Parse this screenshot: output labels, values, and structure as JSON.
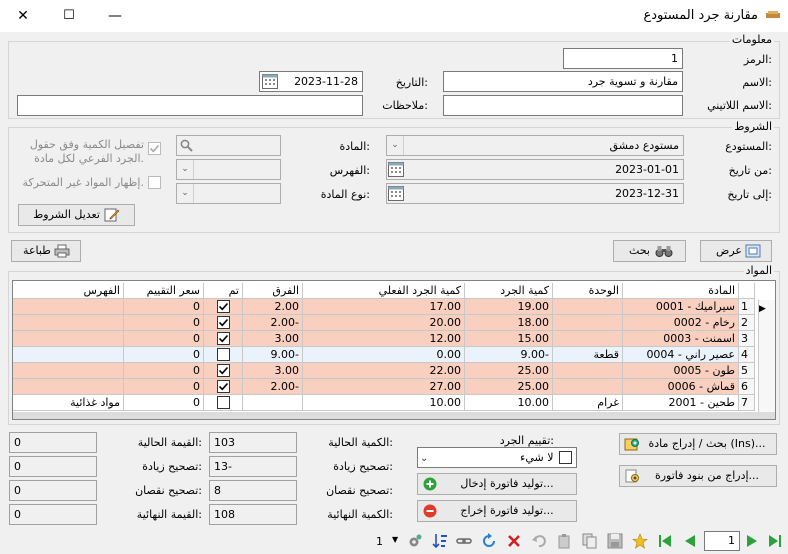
{
  "window": {
    "title": "مقارنة جرد المستودع",
    "minimize": "—",
    "maximize": "☐",
    "close": "✕"
  },
  "info": {
    "group_label": "معلومات",
    "code_label": "الرمز:",
    "code_value": "1",
    "name_label": "الاسم:",
    "name_value": "مقارنة و تسوية جرد",
    "date_label": "التاريخ:",
    "date_value": "2023-11-28",
    "latin_label": "الاسم اللاتيني:",
    "latin_value": "",
    "notes_label": "ملاحظات:",
    "notes_value": ""
  },
  "conditions": {
    "group_label": "الشروط",
    "warehouse_label": "المستودع:",
    "warehouse_value": "مستودع دمشق",
    "from_label": "من تاريخ:",
    "from_value": "2023-01-01",
    "to_label": "إلى تاريخ:",
    "to_value": "2023-12-31",
    "material_label": "المادة:",
    "material_value": "",
    "index_label": "الفهرس:",
    "index_value": "",
    "type_label": "نوع المادة:",
    "type_value": "",
    "detail_check_label": "تفصيل الكمية وفق حقول الجرد الفرعي لكل مادة.",
    "show_moving_label": "إظهار المواد غير المتحركة.",
    "edit_button": "تعديل الشروط"
  },
  "actions": {
    "view": "عرض",
    "search": "بحث",
    "print": "طباعة"
  },
  "materials": {
    "group_label": "المواد",
    "headers": [
      "المادة",
      "الوحدة",
      "كمية الجرد",
      "كمية الجرد الفعلي",
      "الفرق",
      "تم",
      "سعر التقييم",
      "الفهرس"
    ],
    "rows": [
      {
        "num": "1",
        "material": "0001 - سيراميك",
        "unit": "",
        "qty": "19.00",
        "actual": "17.00",
        "diff": "2.00",
        "done": true,
        "price": "0",
        "index": "",
        "bg": "#f9cfc0"
      },
      {
        "num": "2",
        "material": "0002 - رخام",
        "unit": "",
        "qty": "18.00",
        "actual": "20.00",
        "diff": "2.00-",
        "done": true,
        "price": "0",
        "index": "",
        "bg": "#f9cfc0"
      },
      {
        "num": "3",
        "material": "0003 - اسمنت",
        "unit": "",
        "qty": "15.00",
        "actual": "12.00",
        "diff": "3.00",
        "done": true,
        "price": "0",
        "index": "",
        "bg": "#f9cfc0"
      },
      {
        "num": "4",
        "material": "0004 - عصير راني",
        "unit": "قطعة",
        "qty": "9.00-",
        "actual": "0.00",
        "diff": "9.00-",
        "done": false,
        "price": "0",
        "index": "",
        "bg": "#eaf3fb"
      },
      {
        "num": "5",
        "material": "0005 - طون",
        "unit": "",
        "qty": "25.00",
        "actual": "22.00",
        "diff": "3.00",
        "done": true,
        "price": "0",
        "index": "",
        "bg": "#f9cfc0"
      },
      {
        "num": "6",
        "material": "0006 - قماش",
        "unit": "",
        "qty": "25.00",
        "actual": "27.00",
        "diff": "2.00-",
        "done": true,
        "price": "0",
        "index": "",
        "bg": "#f9cfc0"
      },
      {
        "num": "7",
        "material": "2001 - طحين",
        "unit": "غرام",
        "qty": "10.00",
        "actual": "10.00",
        "diff": "",
        "done": false,
        "price": "0",
        "index": "مواد غذائية",
        "bg": "#ffffff"
      }
    ]
  },
  "totals": {
    "current_value_label": "القيمة الحالية:",
    "current_value": "0",
    "add_correction_label": "تصحيح زيادة:",
    "add_correction": "0",
    "sub_correction_label": "تصحيح نقصان:",
    "sub_correction": "0",
    "final_value_label": "القيمة النهائية:",
    "final_value": "0",
    "current_qty_label": "الكمية الحالية:",
    "current_qty": "103",
    "add_qty_label": "تصحيح زيادة:",
    "add_qty": "13-",
    "sub_qty_label": "تصحيح نقصان:",
    "sub_qty": "8",
    "final_qty_label": "الكمية النهائية:",
    "final_qty": "108"
  },
  "evaluation": {
    "label": "تقييم الجرد:",
    "value": "لا شيء",
    "gen_in": "توليد فاتورة إدخال...",
    "gen_out": "توليد فاتورة إخراج..."
  },
  "side_buttons": {
    "search_insert": "بحث / إدراج مادة (Ins)...",
    "insert_invoice": "إدراج من بنود فاتورة..."
  },
  "toolbar": {
    "record_count": "1",
    "page_value": "1"
  },
  "colors": {
    "accent": "#0078d7",
    "row_pink": "#f9cfc0",
    "row_blue": "#eaf3fb"
  }
}
